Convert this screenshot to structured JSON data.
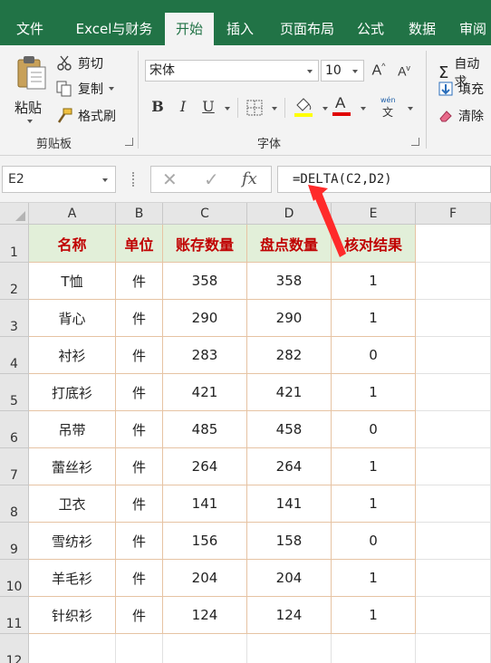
{
  "ribbon_tabs": [
    "文件",
    "Excel与财务",
    "开始",
    "插入",
    "页面布局",
    "公式",
    "数据",
    "审阅"
  ],
  "active_tab": "开始",
  "clipboard": {
    "paste": "粘贴",
    "cut": "剪切",
    "copy": "复制",
    "format_painter": "格式刷",
    "group_label": "剪贴板"
  },
  "font": {
    "font_name": "宋体",
    "font_size": "10",
    "grow": "A",
    "shrink": "A",
    "bold": "B",
    "italic": "I",
    "underline": "U",
    "font_color_letter": "A",
    "phonetic_top": "wén",
    "phonetic_bottom": "文",
    "group_label": "字体"
  },
  "editing": {
    "autosum": "自动求",
    "fill": "填充",
    "clear": "清除"
  },
  "formula_bar": {
    "name_box": "E2",
    "fx": "fx",
    "formula": "=DELTA(C2,D2)"
  },
  "columns": [
    "A",
    "B",
    "C",
    "D",
    "E",
    "F"
  ],
  "rows": [
    "1",
    "2",
    "3",
    "4",
    "5",
    "6",
    "7",
    "8",
    "9",
    "10",
    "11",
    "12"
  ],
  "table": {
    "headers": [
      "名称",
      "单位",
      "账存数量",
      "盘点数量",
      "核对结果"
    ],
    "data": [
      [
        "T恤",
        "件",
        "358",
        "358",
        "1"
      ],
      [
        "背心",
        "件",
        "290",
        "290",
        "1"
      ],
      [
        "衬衫",
        "件",
        "283",
        "282",
        "0"
      ],
      [
        "打底衫",
        "件",
        "421",
        "421",
        "1"
      ],
      [
        "吊带",
        "件",
        "485",
        "458",
        "0"
      ],
      [
        "蕾丝衫",
        "件",
        "264",
        "264",
        "1"
      ],
      [
        "卫衣",
        "件",
        "141",
        "141",
        "1"
      ],
      [
        "雪纺衫",
        "件",
        "156",
        "158",
        "0"
      ],
      [
        "羊毛衫",
        "件",
        "204",
        "204",
        "1"
      ],
      [
        "针织衫",
        "件",
        "124",
        "124",
        "1"
      ]
    ]
  },
  "colors": {
    "excel_green": "#217346",
    "header_fill": "#e2efd9",
    "header_text": "#c00000",
    "cell_border": "#e6c3a3",
    "arrow": "#ff2a2a"
  }
}
